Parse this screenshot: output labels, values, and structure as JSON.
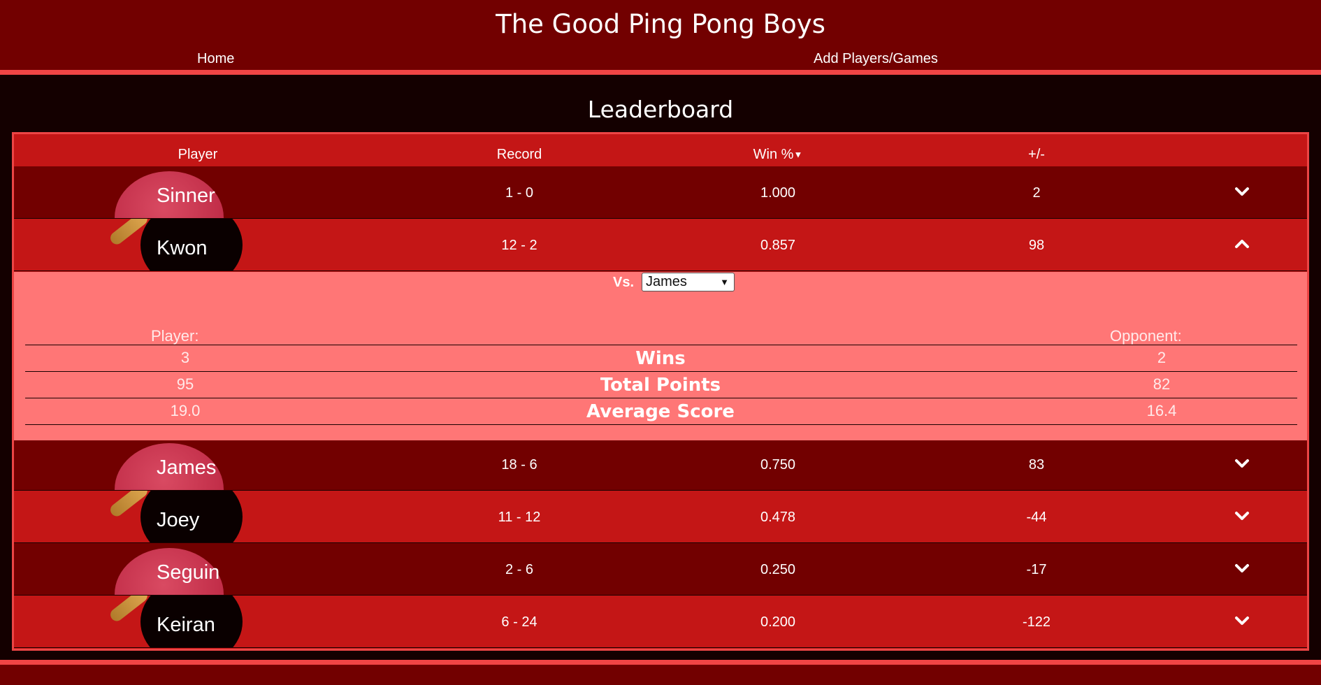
{
  "header": {
    "title": "The Good Ping Pong Boys",
    "nav": {
      "home": "Home",
      "add": "Add Players/Games"
    }
  },
  "leaderboard": {
    "title": "Leaderboard",
    "columns": {
      "player": "Player",
      "record": "Record",
      "win_pct": "Win %",
      "plus_minus": "+/-"
    },
    "rows": [
      {
        "name": "Sinner",
        "record": "1 - 0",
        "win_pct": "1.000",
        "plus_minus": "2",
        "expanded": false
      },
      {
        "name": "Kwon",
        "record": "12 - 2",
        "win_pct": "0.857",
        "plus_minus": "98",
        "expanded": true
      },
      {
        "name": "James",
        "record": "18 - 6",
        "win_pct": "0.750",
        "plus_minus": "83",
        "expanded": false
      },
      {
        "name": "Joey",
        "record": "11 - 12",
        "win_pct": "0.478",
        "plus_minus": "-44",
        "expanded": false
      },
      {
        "name": "Seguin",
        "record": "2 - 6",
        "win_pct": "0.250",
        "plus_minus": "-17",
        "expanded": false
      },
      {
        "name": "Keiran",
        "record": "6 - 24",
        "win_pct": "0.200",
        "plus_minus": "-122",
        "expanded": false
      }
    ],
    "detail": {
      "vs_label": "Vs.",
      "opponent_selected": "James",
      "player_label": "Player:",
      "opponent_label": "Opponent:",
      "stats": [
        {
          "name": "Wins",
          "player": "3",
          "opponent": "2"
        },
        {
          "name": "Total Points",
          "player": "95",
          "opponent": "82"
        },
        {
          "name": "Average Score",
          "player": "19.0",
          "opponent": "16.4"
        }
      ]
    }
  },
  "colors": {
    "header_bg": "#720000",
    "accent": "#f04545",
    "row_dark": "#720000",
    "row_light": "#c41616",
    "detail_bg": "#ff7676",
    "page_bg": "#140000"
  },
  "icons": {
    "sort": "caret-down-icon",
    "collapse": "chevron-down-icon",
    "expand": "chevron-up-icon"
  }
}
